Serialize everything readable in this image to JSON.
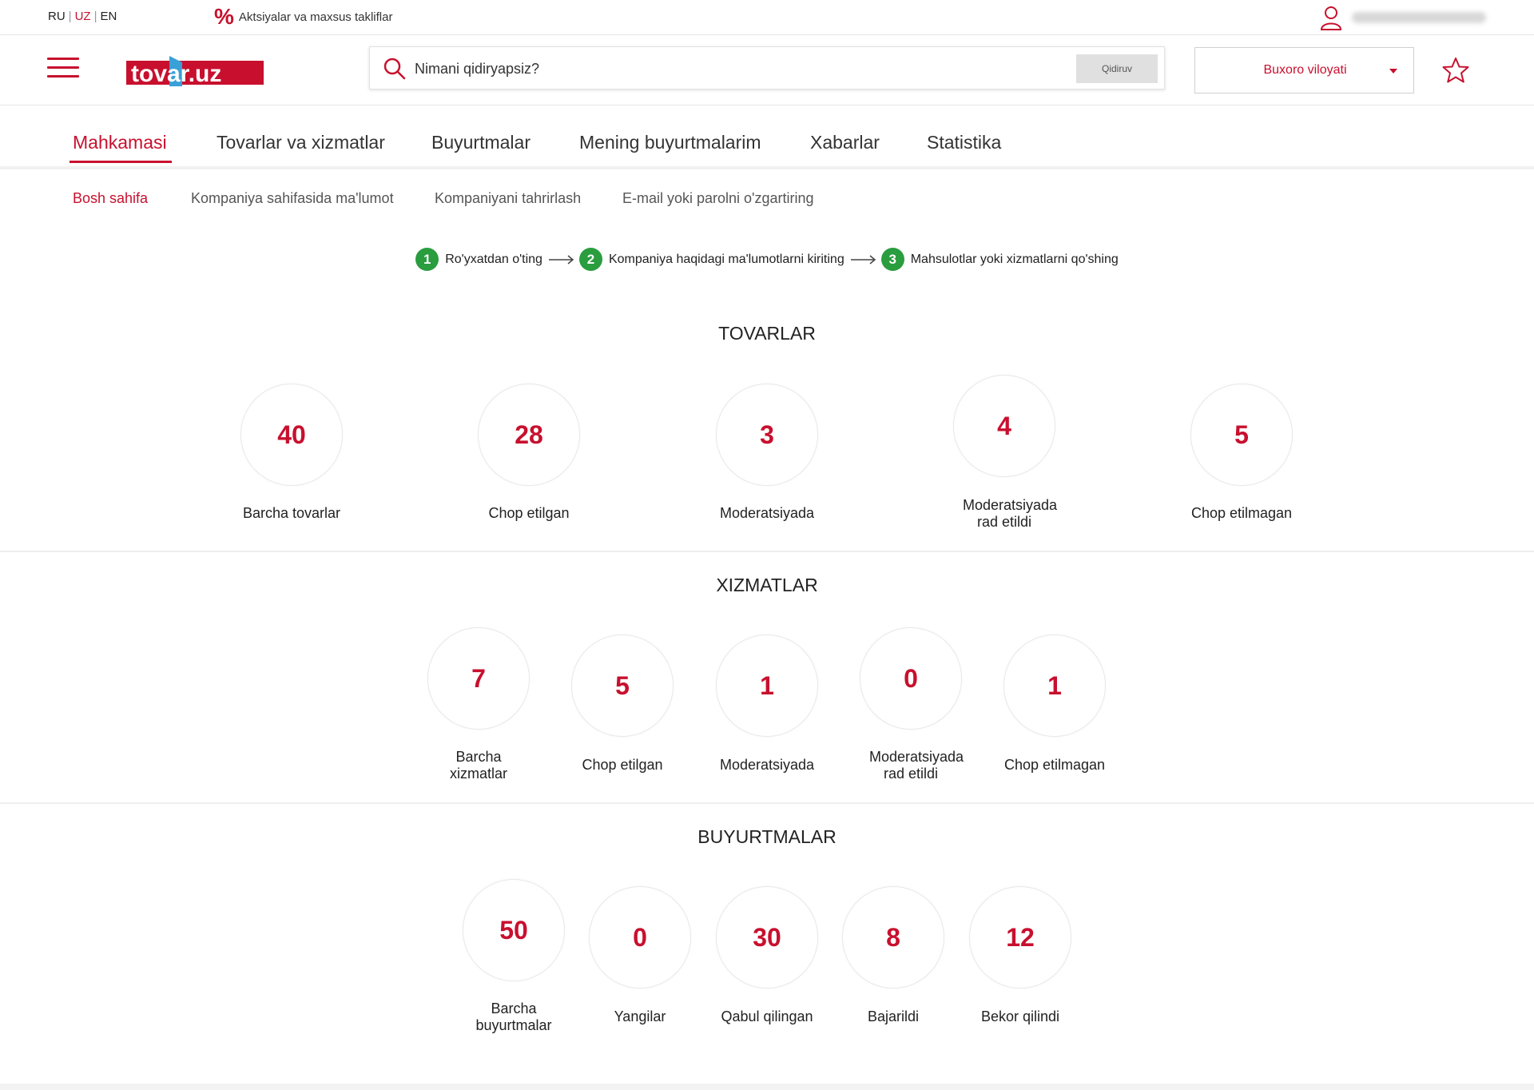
{
  "topbar": {
    "langs": [
      "RU",
      "UZ",
      "EN"
    ],
    "active_lang": "UZ",
    "promo_icon": "%",
    "promo_text": "Aktsiyalar va maxsus takliflar"
  },
  "header": {
    "logo_text": "tovar.uz",
    "search_placeholder": "Nimani qidiryapsiz?",
    "search_button": "Qidiruv",
    "region": "Buxoro viloyati"
  },
  "main_nav": [
    "Mahkamasi",
    "Tovarlar va xizmatlar",
    "Buyurtmalar",
    "Mening buyurtmalarim",
    "Xabarlar",
    "Statistika"
  ],
  "sub_nav": [
    "Bosh sahifa",
    "Kompaniya sahifasida ma'lumot",
    "Kompaniyani tahrirlash",
    "E-mail yoki parolni o'zgartiring"
  ],
  "steps": [
    {
      "num": "1",
      "text": "Ro'yxatdan o'ting"
    },
    {
      "num": "2",
      "text": "Kompaniya haqidagi ma'lumotlarni kiriting"
    },
    {
      "num": "3",
      "text": "Mahsulotlar yoki xizmatlarni qo'shing"
    }
  ],
  "sections": {
    "goods": {
      "title": "TOVARLAR",
      "stats": [
        {
          "value": "40",
          "label": "Barcha tovarlar"
        },
        {
          "value": "28",
          "label": "Chop etilgan"
        },
        {
          "value": "3",
          "label": "Moderatsiyada"
        },
        {
          "value": "4",
          "label": "Moderatsiyada rad etildi"
        },
        {
          "value": "5",
          "label": "Chop etilmagan"
        }
      ]
    },
    "services": {
      "title": "XIZMATLAR",
      "stats": [
        {
          "value": "7",
          "label": "Barcha xizmatlar"
        },
        {
          "value": "5",
          "label": "Chop etilgan"
        },
        {
          "value": "1",
          "label": "Moderatsiyada"
        },
        {
          "value": "0",
          "label": "Moderatsiyada rad etildi"
        },
        {
          "value": "1",
          "label": "Chop etilmagan"
        }
      ]
    },
    "orders": {
      "title": "BUYURTMALAR",
      "stats": [
        {
          "value": "50",
          "label": "Barcha buyurtmalar"
        },
        {
          "value": "0",
          "label": "Yangilar"
        },
        {
          "value": "30",
          "label": "Qabul qilingan"
        },
        {
          "value": "8",
          "label": "Bajarildi"
        },
        {
          "value": "12",
          "label": "Bekor qilindi"
        }
      ]
    }
  },
  "colors": {
    "accent": "#c8102e",
    "step": "#2a9d3f",
    "logo_blue": "#3aa0d8"
  }
}
